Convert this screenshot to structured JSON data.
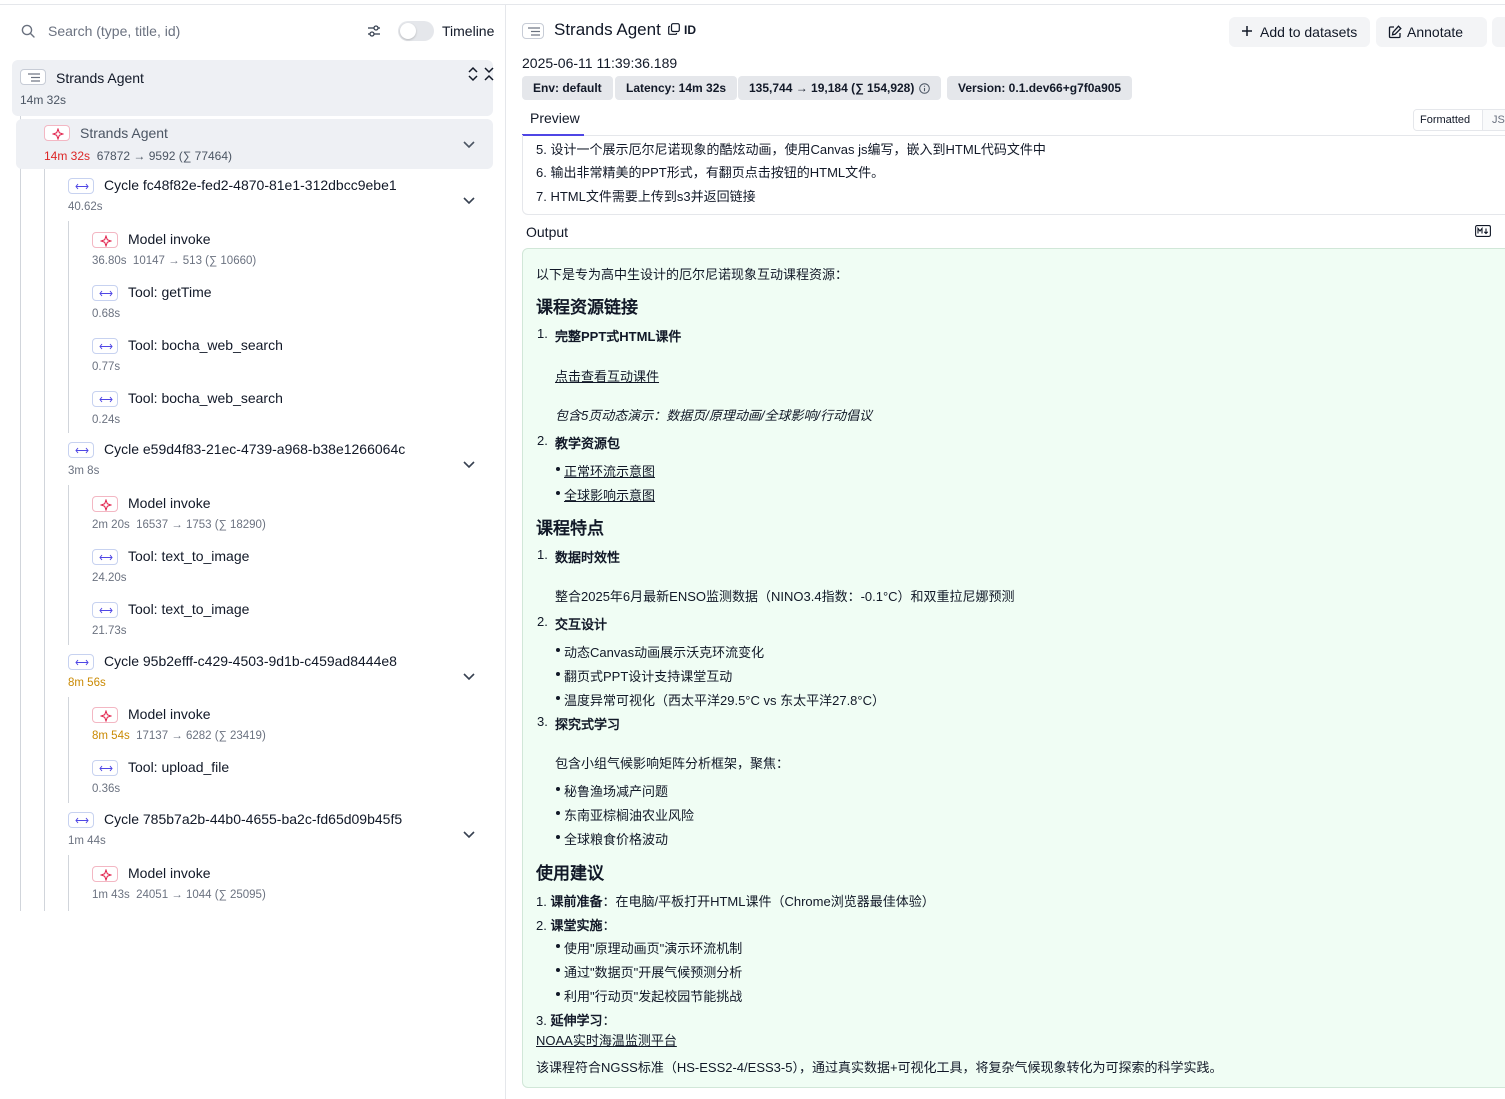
{
  "search": {
    "placeholder": "Search (type, title, id)"
  },
  "timeline_label": "Timeline",
  "tree": {
    "root": {
      "title": "Strands Agent",
      "duration": "14m 32s"
    },
    "agent_span": {
      "title": "Strands Agent",
      "duration": "14m 32s",
      "tokens": "67872 → 9592 (∑ 77464)"
    },
    "cycles": [
      {
        "title": "Cycle fc48f82e-fed2-4870-81e1-312dbcc9ebe1",
        "duration": "40.62s",
        "children": [
          {
            "kind": "llm",
            "title": "Model invoke",
            "duration": "36.80s",
            "tokens": "10147 → 513 (∑ 10660)"
          },
          {
            "kind": "tool",
            "title": "Tool: getTime",
            "duration": "0.68s"
          },
          {
            "kind": "tool",
            "title": "Tool: bocha_web_search",
            "duration": "0.77s"
          },
          {
            "kind": "tool",
            "title": "Tool: bocha_web_search",
            "duration": "0.24s"
          }
        ]
      },
      {
        "title": "Cycle e59d4f83-21ec-4739-a968-b38e1266064c",
        "duration": "3m 8s",
        "children": [
          {
            "kind": "llm",
            "title": "Model invoke",
            "duration": "2m 20s",
            "tokens": "16537 → 1753 (∑ 18290)"
          },
          {
            "kind": "tool",
            "title": "Tool: text_to_image",
            "duration": "24.20s"
          },
          {
            "kind": "tool",
            "title": "Tool: text_to_image",
            "duration": "21.73s"
          }
        ]
      },
      {
        "title": "Cycle 95b2efff-c429-4503-9d1b-c459ad8444e8",
        "duration": "8m 56s",
        "children": [
          {
            "kind": "llm",
            "title": "Model invoke",
            "duration": "8m 54s",
            "tokens": "17137 → 6282 (∑ 23419)"
          },
          {
            "kind": "tool",
            "title": "Tool: upload_file",
            "duration": "0.36s"
          }
        ]
      },
      {
        "title": "Cycle 785b7a2b-44b0-4655-ba2c-fd65d09b45f5",
        "duration": "1m 44s",
        "children": [
          {
            "kind": "llm",
            "title": "Model invoke",
            "duration": "1m 43s",
            "tokens": "24051 → 1044 (∑ 25095)"
          }
        ]
      }
    ]
  },
  "detail": {
    "title": "Strands Agent",
    "id_label": "ID",
    "timestamp": "2025-06-11 11:39:36.189",
    "badges": [
      "Env: default",
      "Latency: 14m 32s",
      "135,744 → 19,184 (∑ 154,928)",
      "Version: 0.1.dev66+g7f0a905"
    ],
    "buttons": {
      "add_to_datasets": "Add to datasets",
      "annotate": "Annotate"
    },
    "tab_preview": "Preview",
    "view_formatted": "Formatted",
    "view_json": "JSON",
    "input_lines": [
      "5. 设计一个展示厄尔尼诺现象的酷炫动画，使用Canvas js编写，嵌入到HTML代码文件中",
      "6. 输出非常精美的PPT形式，有翻页点击按钮的HTML文件。",
      "7. HTML文件需要上传到s3并返回链接"
    ],
    "output_label": "Output",
    "output": {
      "intro": "以下是专为高中生设计的厄尔尼诺现象互动课程资源：",
      "h1": "课程资源链接",
      "item1_num": "1.",
      "item1_title": "完整PPT式HTML课件",
      "item1_link": "点击查看互动课件",
      "item1_note": "包含5页动态演示：数据页/原理动画/全球影响/行动倡议",
      "item2_num": "2.",
      "item2_title": "教学资源包",
      "item2_links": [
        "正常环流示意图",
        "全球影响示意图"
      ],
      "h2": "课程特点",
      "f1_num": "1.",
      "f1_title": "数据时效性",
      "f1_text": "整合2025年6月最新ENSO监测数据（NINO3.4指数：-0.1°C）和双重拉尼娜预测",
      "f2_num": "2.",
      "f2_title": "交互设计",
      "f2_bullets": [
        "动态Canvas动画展示沃克环流变化",
        "翻页式PPT设计支持课堂互动",
        "温度异常可视化（西太平洋29.5°C vs 东太平洋27.8°C）"
      ],
      "f3_num": "3.",
      "f3_title": "探究式学习",
      "f3_text": "包含小组气候影响矩阵分析框架，聚焦：",
      "f3_bullets": [
        "秘鲁渔场减产问题",
        "东南亚棕榈油农业风险",
        "全球粮食价格波动"
      ],
      "h3": "使用建议",
      "u1_prefix": "1. ",
      "u1_title": "课前准备",
      "u1_text": "：在电脑/平板打开HTML课件（Chrome浏览器最佳体验）",
      "u2_prefix": "2. ",
      "u2_title": "课堂实施",
      "u2_colon": "：",
      "u2_bullets": [
        "使用\"原理动画页\"演示环流机制",
        "通过\"数据页\"开展气候预测分析",
        "利用\"行动页\"发起校园节能挑战"
      ],
      "u3_prefix": "3. ",
      "u3_title": "延伸学习",
      "u3_colon": "：",
      "u3_link": "NOAA实时海温监测平台",
      "closing": "该课程符合NGSS标准（HS-ESS2-4/ESS3-5），通过真实数据+可视化工具，将复杂气候现象转化为可探索的科学实践。"
    }
  },
  "colors": {
    "accent": "#4f46e5",
    "duration_slow": "#dc2626",
    "duration_warn": "#ca8a04",
    "output_bg": "#f0fdf4"
  },
  "icons": [
    "search-icon",
    "sliders-icon",
    "agent-icon",
    "llm-icon",
    "tool-icon",
    "chevron-down-icon",
    "expand-icon",
    "collapse-icon",
    "copy-icon",
    "plus-icon",
    "edit-icon",
    "info-icon",
    "markdown-icon",
    "comment-icon"
  ]
}
